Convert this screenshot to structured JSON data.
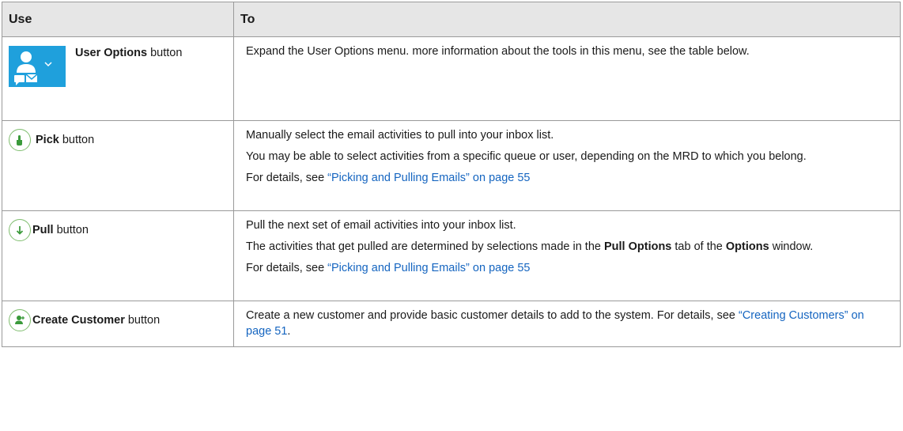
{
  "table": {
    "header": {
      "use": "Use",
      "to": "To"
    },
    "rows": [
      {
        "icon": "user-options-icon",
        "label_bold": "User Options",
        "label_rest": " button",
        "desc": [
          {
            "text": "Expand the User Options menu. more information about the tools in this menu, see the table below."
          }
        ]
      },
      {
        "icon": "pick-hand-icon",
        "label_bold": "Pick",
        "label_rest": " button",
        "desc": [
          {
            "text": "Manually select the email activities to pull into your inbox list."
          },
          {
            "text": "You may be able to select activities from a specific queue or user, depending on the MRD to which you belong."
          },
          {
            "pre": "For details, see ",
            "link": "“Picking and Pulling Emails” on page 55"
          }
        ]
      },
      {
        "icon": "pull-arrow-icon",
        "label_bold": "Pull",
        "label_rest": " button",
        "desc": [
          {
            "text": "Pull the next set of email activities into your inbox list."
          },
          {
            "t1": "The activities that get pulled are determined by selections made in the ",
            "b1": "Pull Options",
            "t2": " tab of the ",
            "b2": "Options",
            "t3": " window."
          },
          {
            "pre": "For details, see ",
            "link": "“Picking and Pulling Emails” on page 55"
          }
        ]
      },
      {
        "icon": "create-customer-icon",
        "label_bold": "Create Customer",
        "label_rest": " button",
        "desc": [
          {
            "pre": "Create a new customer and provide basic customer details to add to the system. For details, see ",
            "link": "“Creating Customers” on page 51",
            "post": "."
          }
        ]
      }
    ]
  },
  "colors": {
    "header_bg": "#e6e6e6",
    "link": "#1565c0",
    "icon_green": "#3a9a3a",
    "user_options_blue": "#1fa0dc"
  }
}
